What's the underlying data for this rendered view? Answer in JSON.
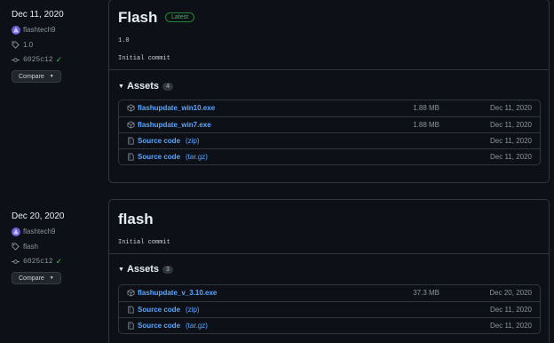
{
  "releases": [
    {
      "date": "Dec 11, 2020",
      "author": "flashtech9",
      "tag": "1.0",
      "commit": "6025c12",
      "compare_label": "Compare",
      "title": "Flash",
      "badge": "Latest",
      "version_text": "1.0",
      "body": "Initial commit",
      "assets_label": "Assets",
      "assets_count": "4",
      "assets": [
        {
          "name": "flashupdate_win10.exe",
          "sub": "",
          "size": "1.88 MB",
          "date": "Dec 11, 2020"
        },
        {
          "name": "flashupdate_win7.exe",
          "sub": "",
          "size": "1.88 MB",
          "date": "Dec 11, 2020"
        },
        {
          "name": "Source code",
          "sub": "(zip)",
          "size": "",
          "date": "Dec 11, 2020"
        },
        {
          "name": "Source code",
          "sub": "(tar.gz)",
          "size": "",
          "date": "Dec 11, 2020"
        }
      ]
    },
    {
      "date": "Dec 20, 2020",
      "author": "flashtech9",
      "tag": "flash",
      "commit": "6025c12",
      "compare_label": "Compare",
      "title": "flash",
      "body": "Initial commit",
      "assets_label": "Assets",
      "assets_count": "3",
      "assets": [
        {
          "name": "flashupdate_v_3.10.exe",
          "sub": "",
          "size": "37.3 MB",
          "date": "Dec 20, 2020"
        },
        {
          "name": "Source code",
          "sub": "(zip)",
          "size": "",
          "date": "Dec 11, 2020"
        },
        {
          "name": "Source code",
          "sub": "(tar.gz)",
          "size": "",
          "date": "Dec 11, 2020"
        }
      ]
    }
  ]
}
